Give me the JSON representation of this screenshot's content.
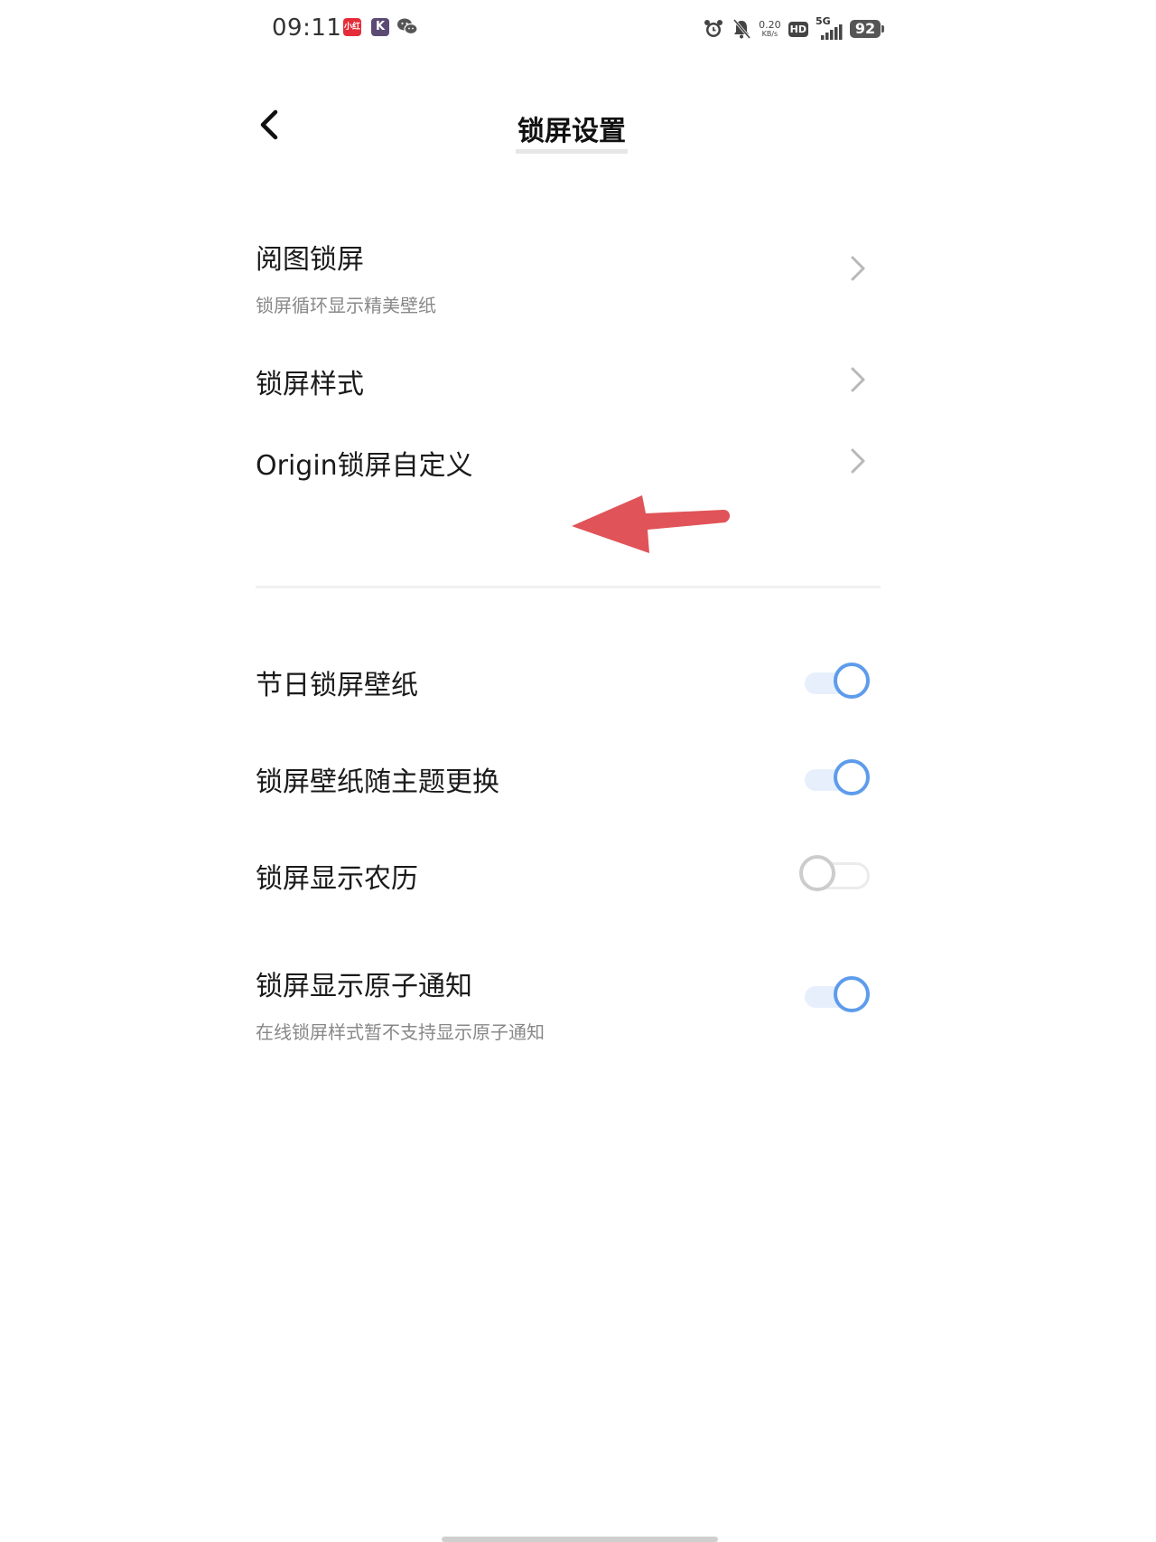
{
  "status_bar": {
    "time": "09:11",
    "app_icons": [
      "red-app-icon",
      "k-app-icon",
      "wechat-icon"
    ],
    "red_app_label": "小红书",
    "k_app_label": "K",
    "net_speed_value": "0.20",
    "net_speed_unit": "KB/s",
    "hd_label": "HD",
    "network_label": "5G",
    "battery_level": "92"
  },
  "header": {
    "title": "锁屏设置",
    "back_icon": "chevron-left-icon"
  },
  "menu_items": [
    {
      "title": "阅图锁屏",
      "subtitle": "锁屏循环显示精美壁纸"
    },
    {
      "title": "锁屏样式"
    },
    {
      "title": "Origin锁屏自定义"
    }
  ],
  "toggle_items": [
    {
      "title": "节日锁屏壁纸",
      "enabled": true
    },
    {
      "title": "锁屏壁纸随主题更换",
      "enabled": true
    },
    {
      "title": "锁屏显示农历",
      "enabled": false
    },
    {
      "title": "锁屏显示原子通知",
      "subtitle": "在线锁屏样式暂不支持显示原子通知",
      "enabled": true
    }
  ],
  "colors": {
    "toggle_on": "#5d9cec",
    "toggle_on_track": "#e6effb",
    "toggle_off": "#cccccc",
    "annotation_arrow": "#e05358"
  }
}
